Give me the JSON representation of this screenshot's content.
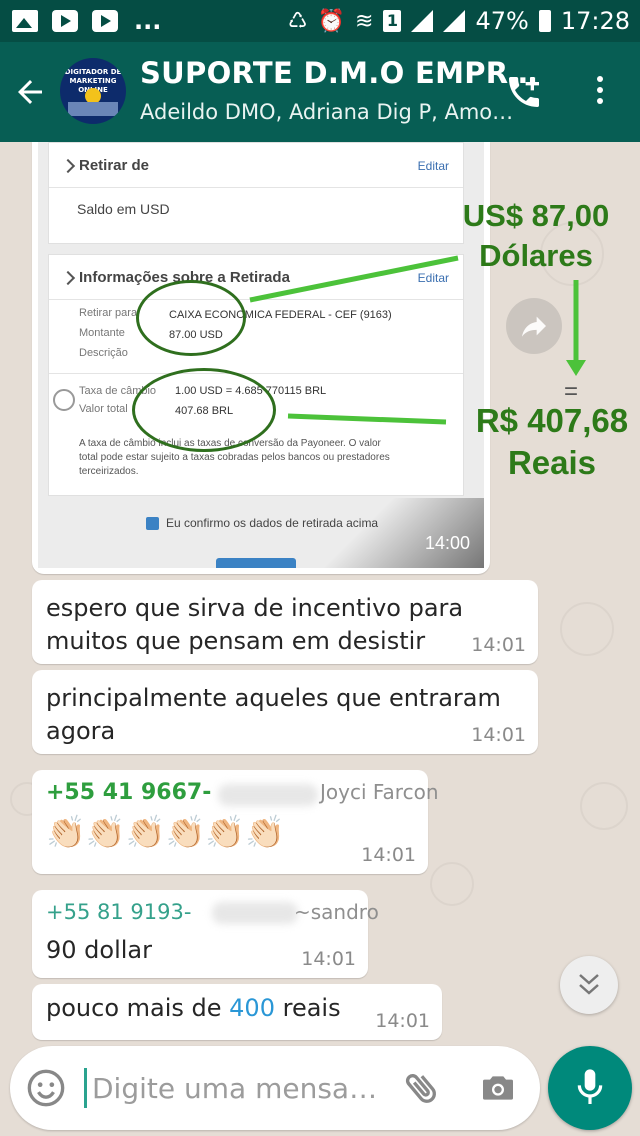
{
  "status_bar": {
    "dots": "...",
    "sim": "1",
    "battery_pct": "47%",
    "time": "17:28"
  },
  "header": {
    "title": "SUPORTE D.M.O EMPR…",
    "subtitle": "Adeildo DMO, Adriana Dig P, Amo…",
    "avatar_text": "DIGITADOR DE MARKETING ONLINE"
  },
  "image_message": {
    "card1_title": "Retirar de",
    "card1_edit": "Editar",
    "saldo": "Saldo em USD",
    "card2_title": "Informações sobre a Retirada",
    "card2_edit": "Editar",
    "retirar_para_label": "Retirar para",
    "retirar_para_value": "CAIXA ECONOMICA FEDERAL - CEF (9163)",
    "montante_label": "Montante",
    "montante_value": "87.00 USD",
    "descricao_label": "Descrição",
    "taxa_label": "Taxa de câmbio",
    "taxa_value": "1.00 USD = 4.685 770115 BRL",
    "valor_label": "Valor total",
    "valor_value": "407.68 BRL",
    "note": "A taxa de câmbio inclui as taxas de conversão da Payoneer. O valor total pode estar sujeito a taxas cobradas pelos bancos ou prestadores terceirizados.",
    "confirm": "Eu confirmo os dados de retirada acima",
    "time": "14:00"
  },
  "annotations": {
    "usd_amount": "US$ 87,00",
    "usd_label": "Dólares",
    "brl_amount": "R$ 407,68",
    "brl_label": "Reais",
    "equals": "="
  },
  "messages": [
    {
      "text": "espero que sirva de incentivo para muitos que pensam em desistir",
      "time": "14:01"
    },
    {
      "text": "principalmente aqueles que entraram agora",
      "time": "14:01"
    },
    {
      "sender": "+55 41 9667-",
      "alias": "Joyci Farcon",
      "text": "👏🏻👏🏻👏🏻👏🏻👏🏻👏🏻",
      "time": "14:01",
      "sender_color": "#2e9e3e"
    },
    {
      "sender": "+55 81 9193-",
      "alias": "~sandro",
      "text": "90 dollar",
      "time": "14:01",
      "sender_color": "#35a18b"
    },
    {
      "text_before": "pouco mais de ",
      "highlight": "400",
      "text_after": " reais",
      "time": "14:01"
    }
  ],
  "composer": {
    "placeholder": "Digite uma mensa…"
  },
  "colors": {
    "header": "#075e54",
    "status_bar": "#054d44",
    "annotation_green": "#2d7a19",
    "fab": "#00897b"
  }
}
